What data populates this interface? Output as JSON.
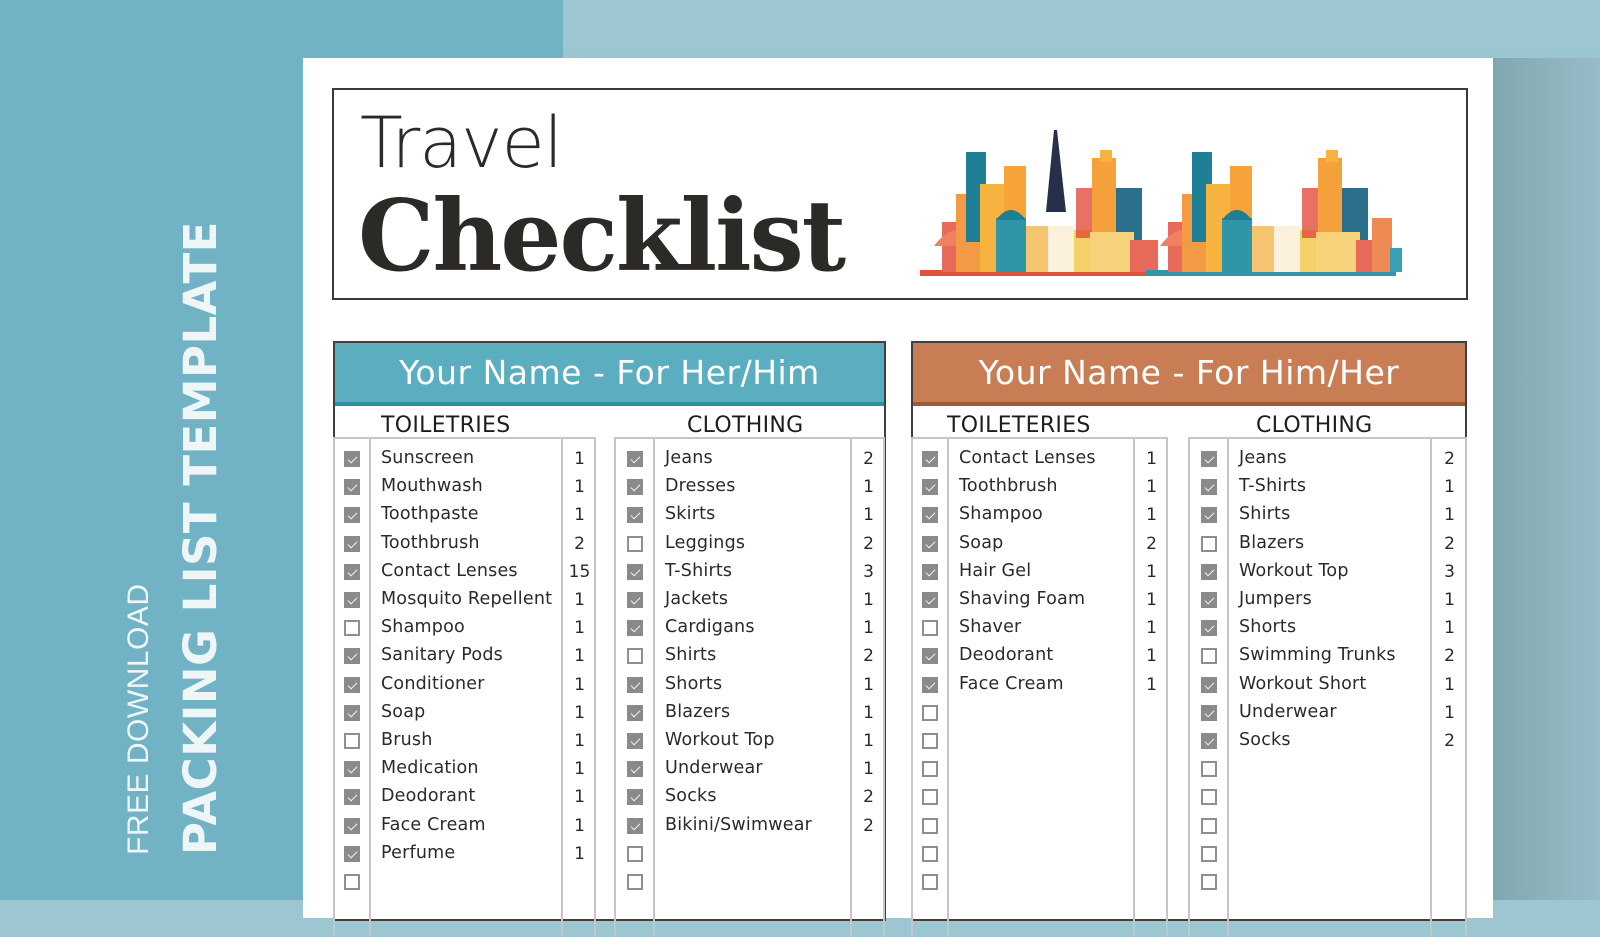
{
  "promo": {
    "small_text": "FREE DOWNLOAD",
    "big_text": "PACKING LIST TEMPLATE"
  },
  "header": {
    "title_line1": "Travel",
    "title_line2": "Checklist",
    "illustration": "city-skyline-illustration"
  },
  "colors": {
    "left_accent": "#5aaebf",
    "right_accent": "#c97d54",
    "checked_box": "#8a8a8a",
    "background_left": "#71b3c4",
    "background_right": "#9dc6d3"
  },
  "panels": [
    {
      "title": "Your Name - For Her/Him",
      "sections": [
        {
          "heading": "TOILETRIES",
          "items": [
            {
              "label": "Sunscreen",
              "qty": "1",
              "checked": true
            },
            {
              "label": "Mouthwash",
              "qty": "1",
              "checked": true
            },
            {
              "label": "Toothpaste",
              "qty": "1",
              "checked": true
            },
            {
              "label": "Toothbrush",
              "qty": "2",
              "checked": true
            },
            {
              "label": "Contact Lenses",
              "qty": "15",
              "checked": true
            },
            {
              "label": "Mosquito Repellent",
              "qty": "1",
              "checked": true
            },
            {
              "label": "Shampoo",
              "qty": "1",
              "checked": false
            },
            {
              "label": "Sanitary Pods",
              "qty": "1",
              "checked": true
            },
            {
              "label": "Conditioner",
              "qty": "1",
              "checked": true
            },
            {
              "label": "Soap",
              "qty": "1",
              "checked": true
            },
            {
              "label": "Brush",
              "qty": "1",
              "checked": false
            },
            {
              "label": "Medication",
              "qty": "1",
              "checked": true
            },
            {
              "label": "Deodorant",
              "qty": "1",
              "checked": true
            },
            {
              "label": "Face Cream",
              "qty": "1",
              "checked": true
            },
            {
              "label": "Perfume",
              "qty": "1",
              "checked": true
            },
            {
              "label": "",
              "qty": "",
              "checked": false
            }
          ]
        },
        {
          "heading": "CLOTHING",
          "items": [
            {
              "label": "Jeans",
              "qty": "2",
              "checked": true
            },
            {
              "label": "Dresses",
              "qty": "1",
              "checked": true
            },
            {
              "label": "Skirts",
              "qty": "1",
              "checked": true
            },
            {
              "label": "Leggings",
              "qty": "2",
              "checked": false
            },
            {
              "label": "T-Shirts",
              "qty": "3",
              "checked": true
            },
            {
              "label": "Jackets",
              "qty": "1",
              "checked": true
            },
            {
              "label": "Cardigans",
              "qty": "1",
              "checked": true
            },
            {
              "label": "Shirts",
              "qty": "2",
              "checked": false
            },
            {
              "label": "Shorts",
              "qty": "1",
              "checked": true
            },
            {
              "label": "Blazers",
              "qty": "1",
              "checked": true
            },
            {
              "label": "Workout Top",
              "qty": "1",
              "checked": true
            },
            {
              "label": "Underwear",
              "qty": "1",
              "checked": true
            },
            {
              "label": "Socks",
              "qty": "2",
              "checked": true
            },
            {
              "label": "Bikini/Swimwear",
              "qty": "2",
              "checked": true
            },
            {
              "label": "",
              "qty": "",
              "checked": false
            },
            {
              "label": "",
              "qty": "",
              "checked": false
            }
          ]
        }
      ]
    },
    {
      "title": "Your Name - For Him/Her",
      "sections": [
        {
          "heading": "TOILETERIES",
          "items": [
            {
              "label": "Contact Lenses",
              "qty": "1",
              "checked": true
            },
            {
              "label": "Toothbrush",
              "qty": "1",
              "checked": true
            },
            {
              "label": "Shampoo",
              "qty": "1",
              "checked": true
            },
            {
              "label": "Soap",
              "qty": "2",
              "checked": true
            },
            {
              "label": "Hair Gel",
              "qty": "1",
              "checked": true
            },
            {
              "label": "Shaving Foam",
              "qty": "1",
              "checked": true
            },
            {
              "label": "Shaver",
              "qty": "1",
              "checked": false
            },
            {
              "label": "Deodorant",
              "qty": "1",
              "checked": true
            },
            {
              "label": "Face Cream",
              "qty": "1",
              "checked": true
            },
            {
              "label": "",
              "qty": "",
              "checked": false
            },
            {
              "label": "",
              "qty": "",
              "checked": false
            },
            {
              "label": "",
              "qty": "",
              "checked": false
            },
            {
              "label": "",
              "qty": "",
              "checked": false
            },
            {
              "label": "",
              "qty": "",
              "checked": false
            },
            {
              "label": "",
              "qty": "",
              "checked": false
            },
            {
              "label": "",
              "qty": "",
              "checked": false
            }
          ]
        },
        {
          "heading": "CLOTHING",
          "items": [
            {
              "label": "Jeans",
              "qty": "2",
              "checked": true
            },
            {
              "label": "T-Shirts",
              "qty": "1",
              "checked": true
            },
            {
              "label": "Shirts",
              "qty": "1",
              "checked": true
            },
            {
              "label": "Blazers",
              "qty": "2",
              "checked": false
            },
            {
              "label": "Workout Top",
              "qty": "3",
              "checked": true
            },
            {
              "label": "Jumpers",
              "qty": "1",
              "checked": true
            },
            {
              "label": "Shorts",
              "qty": "1",
              "checked": true
            },
            {
              "label": "Swimming Trunks",
              "qty": "2",
              "checked": false
            },
            {
              "label": "Workout Short",
              "qty": "1",
              "checked": true
            },
            {
              "label": "Underwear",
              "qty": "1",
              "checked": true
            },
            {
              "label": "Socks",
              "qty": "2",
              "checked": true
            },
            {
              "label": "",
              "qty": "",
              "checked": false
            },
            {
              "label": "",
              "qty": "",
              "checked": false
            },
            {
              "label": "",
              "qty": "",
              "checked": false
            },
            {
              "label": "",
              "qty": "",
              "checked": false
            },
            {
              "label": "",
              "qty": "",
              "checked": false
            }
          ]
        }
      ]
    }
  ]
}
